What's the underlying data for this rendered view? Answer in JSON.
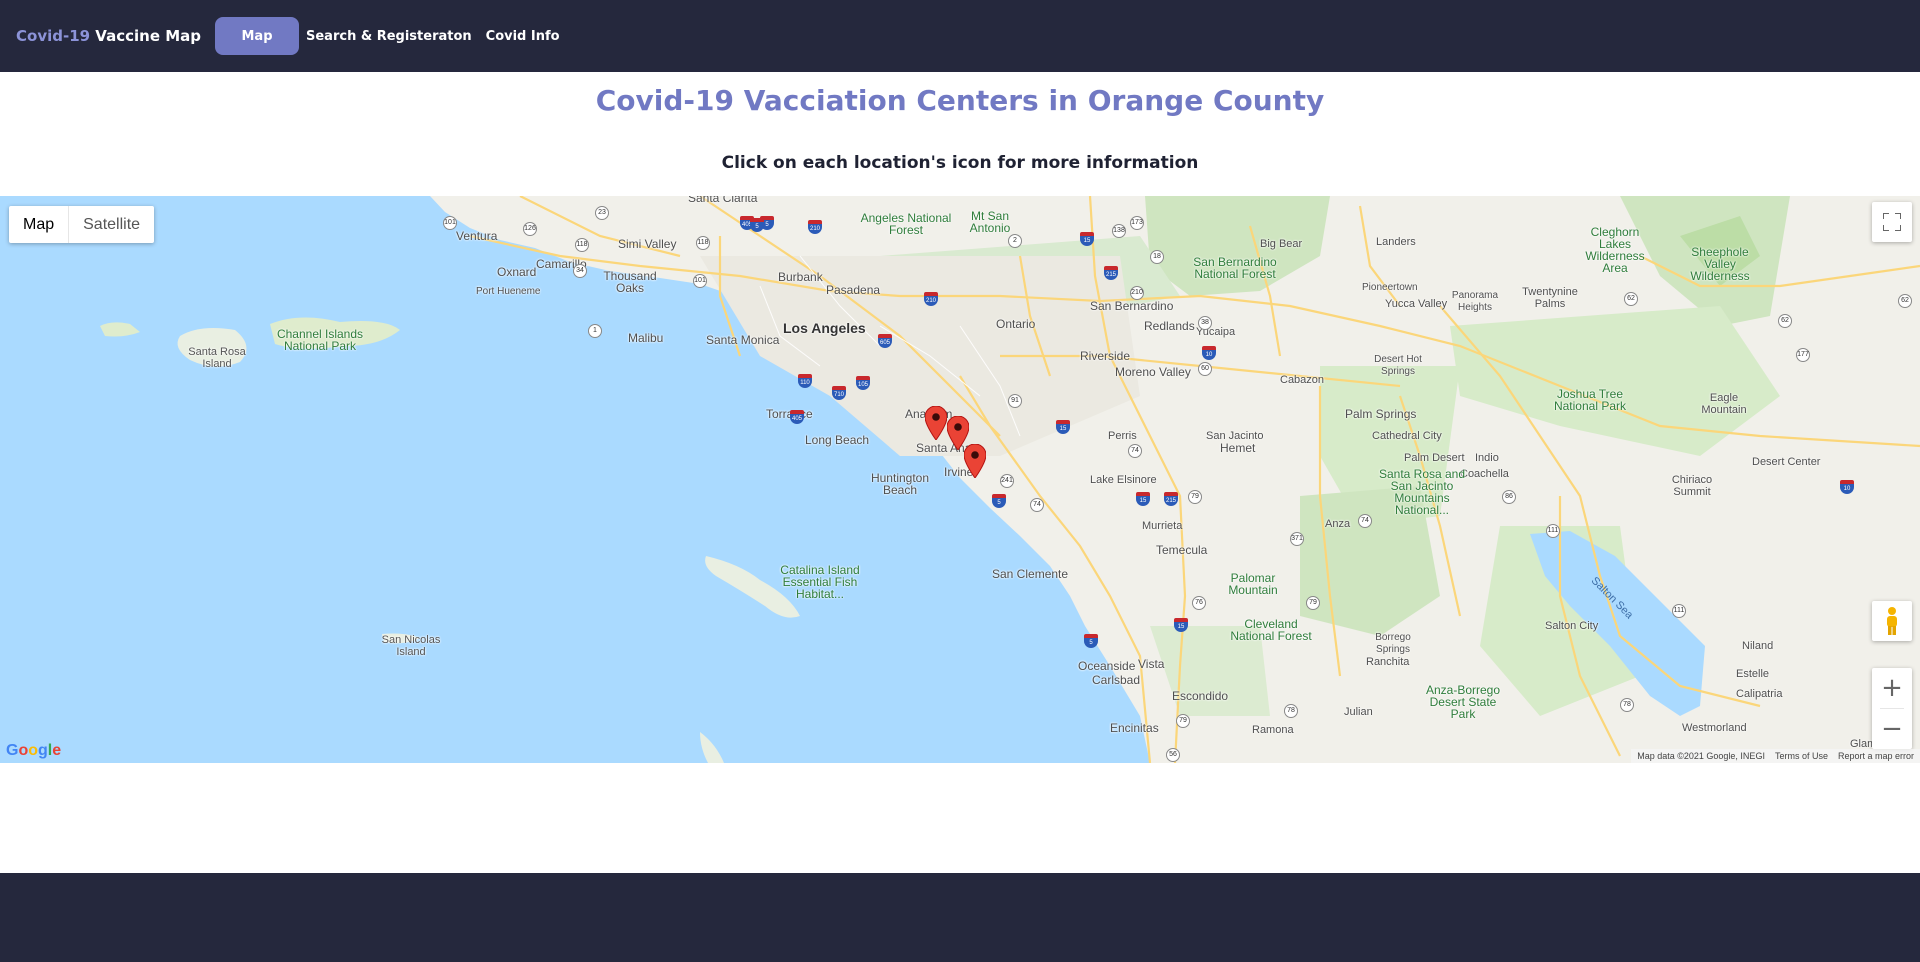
{
  "navbar": {
    "brand_accent": "Covid-19",
    "brand_rest": " Vaccine Map",
    "items": [
      {
        "label": "Map",
        "active": true
      },
      {
        "label": "Search & Registeraton",
        "active": false
      },
      {
        "label": "Covid Info",
        "active": false
      }
    ]
  },
  "page": {
    "title": "Covid-19 Vacciation Centers in Orange County",
    "subtitle": "Click on each location's icon for more information"
  },
  "map": {
    "type_control": {
      "map_label": "Map",
      "satellite_label": "Satellite",
      "selected": "Map"
    },
    "controls": {
      "fullscreen_icon": "fullscreen-icon",
      "pegman_icon": "pegman-icon",
      "zoom_in": "+",
      "zoom_out": "−"
    },
    "logo": "Google",
    "attribution": {
      "data": "Map data ©2021 Google, INEGI",
      "terms": "Terms of Use",
      "report": "Report a map error"
    },
    "labels": {
      "santa_clarita": "Santa Clarita",
      "ventura": "Ventura",
      "simi_valley": "Simi Valley",
      "oxnard": "Oxnard",
      "camarillo": "Camarillo",
      "thousand_oaks": "Thousand Oaks",
      "port_hueneme": "Port Hueneme",
      "angeles_nf": "Angeles National Forest",
      "mt_san_antonio": "Mt San Antonio",
      "burbank": "Burbank",
      "pasadena": "Pasadena",
      "los_angeles": "Los Angeles",
      "santa_monica": "Santa Monica",
      "malibu": "Malibu",
      "torrance": "Torrance",
      "long_beach": "Long Beach",
      "anaheim": "Anaheim",
      "santa_ana": "Santa Ana",
      "irvine": "Irvine",
      "huntington_beach": "Huntington Beach",
      "ontario": "Ontario",
      "riverside": "Riverside",
      "san_bernardino": "San Bernardino",
      "redlands": "Redlands",
      "yucaipa": "Yucaipa",
      "moreno_valley": "Moreno Valley",
      "perris": "Perris",
      "hemet": "Hemet",
      "san_jacinto": "San Jacinto",
      "lake_elsinore": "Lake Elsinore",
      "murrieta": "Murrieta",
      "temecula": "Temecula",
      "san_clemente": "San Clemente",
      "oceanside": "Oceanside",
      "carlsbad": "Carlsbad",
      "vista": "Vista",
      "escondido": "Escondido",
      "encinitas": "Encinitas",
      "ramona": "Ramona",
      "julian": "Julian",
      "big_bear": "Big Bear",
      "sb_nf": "San Bernardino National Forest",
      "landers": "Landers",
      "pioneertown": "Pioneertown",
      "yucca_valley": "Yucca Valley",
      "twentynine_palms": "Twentynine Palms",
      "panorama_heights": "Panorama Heights",
      "cleghorn": "Cleghorn Lakes Wilderness Area",
      "sheephole": "Sheephole Valley Wilderness",
      "desert_hot_springs": "Desert Hot Springs",
      "cabazon": "Cabazon",
      "palm_springs": "Palm Springs",
      "cathedral_city": "Cathedral City",
      "palm_desert": "Palm Desert",
      "indio": "Indio",
      "coachella": "Coachella",
      "joshua_tree": "Joshua Tree National Park",
      "eagle_mountain": "Eagle Mountain",
      "desert_center": "Desert Center",
      "chiriaco": "Chiriaco Summit",
      "santa_rosa_mtns": "Santa Rosa and San Jacinto Mountains National...",
      "anza": "Anza",
      "palomar": "Palomar Mountain",
      "cleveland_nf": "Cleveland National Forest",
      "borrego": "Borrego Springs",
      "ranchita": "Ranchita",
      "anza_borrego": "Anza-Borrego Desert State Park",
      "salton_city": "Salton City",
      "salton_sea": "Salton Sea",
      "niland": "Niland",
      "estelle": "Estelle",
      "calipatria": "Calipatria",
      "westmorland": "Westmorland",
      "glamis": "Glamis",
      "santa_rosa_island": "Santa Rosa Island",
      "channel_islands": "Channel Islands National Park",
      "catalina": "Catalina Island Essential Fish Habitat...",
      "san_nicolas": "San Nicolas Island"
    },
    "markers": [
      {
        "name": "vaccination-center-marker-1",
        "lat": 33.84,
        "lng": -117.91
      },
      {
        "name": "vaccination-center-marker-2",
        "lat": 33.8,
        "lng": -117.85
      },
      {
        "name": "vaccination-center-marker-3",
        "lat": 33.69,
        "lng": -117.8
      }
    ],
    "marker_color": "#ea4335"
  },
  "colors": {
    "navbar_bg": "#25283d",
    "accent": "#7179c3",
    "footer_bg": "#25283d"
  }
}
